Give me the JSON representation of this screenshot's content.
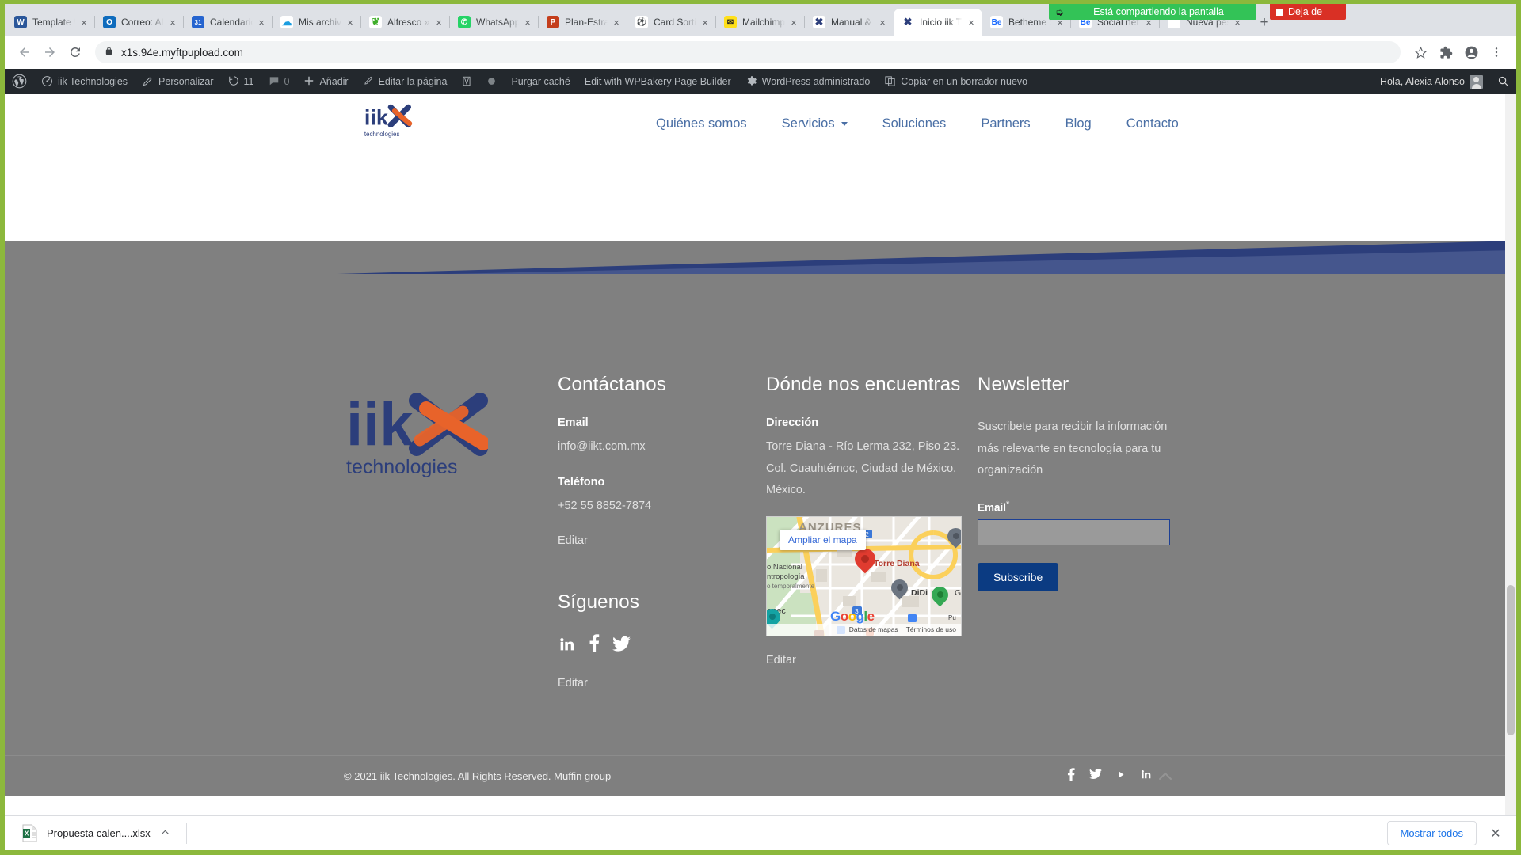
{
  "browser": {
    "tabs": [
      {
        "title": "Template W",
        "icon": "document-icon",
        "icon_bg": "#2b579a",
        "glyph": "W"
      },
      {
        "title": "Correo: Ale",
        "icon": "outlook-icon",
        "icon_bg": "#0f6cbd",
        "glyph": "O"
      },
      {
        "title": "Calendario:",
        "icon": "calendar-icon",
        "icon_bg": "#2564cf",
        "glyph": "31"
      },
      {
        "title": "Mis archivos",
        "icon": "onedrive-icon",
        "icon_bg": "#ffffff",
        "glyph": "☁"
      },
      {
        "title": "Alfresco » P",
        "icon": "alfresco-icon",
        "icon_bg": "#ffffff",
        "glyph": "❦"
      },
      {
        "title": "WhatsApp",
        "icon": "whatsapp-icon",
        "icon_bg": "#25d366",
        "glyph": "✆"
      },
      {
        "title": "Plan-Estrat",
        "icon": "powerpoint-icon",
        "icon_bg": "#c43e1c",
        "glyph": "P"
      },
      {
        "title": "Card Sorting",
        "icon": "optimal-workshop-icon",
        "icon_bg": "#ffffff",
        "glyph": "⚽"
      },
      {
        "title": "Mailchimp D",
        "icon": "mailchimp-icon",
        "icon_bg": "#ffe01b",
        "glyph": "✉"
      },
      {
        "title": "Manual & S",
        "icon": "iik-icon",
        "icon_bg": "#ffffff",
        "glyph": "✖"
      },
      {
        "title": "Inicio iik T",
        "icon": "iik-icon",
        "icon_bg": "#ffffff",
        "glyph": "✖",
        "active": true
      },
      {
        "title": "Betheme St",
        "icon": "behance-icon",
        "icon_bg": "#ffffff",
        "glyph": "Be"
      },
      {
        "title": "Social netw",
        "icon": "behance-icon",
        "icon_bg": "#ffffff",
        "glyph": "Be"
      },
      {
        "title": "Nueva pestaña",
        "icon": "blank-icon",
        "icon_bg": "#ffffff",
        "glyph": ""
      }
    ],
    "new_tab_label": "+",
    "close_label": "×",
    "share_notice": "Está compartiendo la pantalla",
    "stop_share_label": "Deja de",
    "back_label": "←",
    "forward_label": "→",
    "reload_label": "⟳",
    "url": "x1s.94e.myftpupload.com",
    "lock_label": "🔒",
    "bookmark_label": "☆",
    "extensions_label": "🧩",
    "profile_label": "👤",
    "menu_label": "⋮"
  },
  "wp_admin_bar": {
    "items": [
      {
        "label": "",
        "icon": "wordpress-logo-icon"
      },
      {
        "label": "iik Technologies",
        "icon": "dashboard-icon"
      },
      {
        "label": "Personalizar",
        "icon": "pencil-icon"
      },
      {
        "label": "11",
        "icon": "revision-icon"
      },
      {
        "label": "0",
        "icon": "comment-icon"
      },
      {
        "label": "Añadir",
        "icon": "plus-icon"
      },
      {
        "label": "Editar la página",
        "icon": "edit-icon"
      },
      {
        "label": "",
        "icon": "wpbakery-icon"
      },
      {
        "label": "Purgar caché",
        "icon": "cache-icon"
      },
      {
        "label": "Edit with WPBakery Page Builder",
        "icon": ""
      },
      {
        "label": "WordPress administrado",
        "icon": "gear-icon"
      },
      {
        "label": "Copiar en un borrador nuevo",
        "icon": "copy-icon"
      }
    ],
    "greeting": "Hola, Alexia Alonso",
    "search_icon": "search-icon"
  },
  "site": {
    "logo_main": "iik",
    "logo_sub": "technologies",
    "nav": [
      {
        "label": "Quiénes somos",
        "has_dropdown": false
      },
      {
        "label": "Servicios",
        "has_dropdown": true
      },
      {
        "label": "Soluciones",
        "has_dropdown": false
      },
      {
        "label": "Partners",
        "has_dropdown": false
      },
      {
        "label": "Blog",
        "has_dropdown": false
      },
      {
        "label": "Contacto",
        "has_dropdown": false
      }
    ],
    "accent_blue": "#2c3e7b",
    "footer_bg": "#808080"
  },
  "footer": {
    "contact": {
      "heading": "Contáctanos",
      "email_label": "Email",
      "email_value": "info@iikt.com.mx",
      "phone_label": "Teléfono",
      "phone_value": "+52 55 8852-7874",
      "edit_label": "Editar",
      "follow_heading": "Síguenos",
      "social": [
        "linkedin-icon",
        "facebook-icon",
        "twitter-icon"
      ],
      "follow_edit_label": "Editar"
    },
    "location": {
      "heading": "Dónde nos encuentras",
      "address_label": "Dirección",
      "address_lines": [
        "Torre Diana - Río Lerma 232, Piso 23.",
        "Col. Cuauhtémoc, Ciudad de México,",
        "México."
      ],
      "edit_label": "Editar",
      "map": {
        "expand_label": "Ampliar el mapa",
        "marker_label": "Torre Diana",
        "poi_didi": "DiDi",
        "poi_anzures": "ANZURES",
        "poi_museum_1": "o Nacional",
        "poi_museum_2": "ntropología",
        "poi_museum_3": "o temporalmente",
        "poi_chapultepec": "epec",
        "route_2": "2",
        "route_3": "3",
        "brand": "Google",
        "data_label": "Datos de mapas",
        "terms_label": "Términos de uso"
      }
    },
    "newsletter": {
      "heading": "Newsletter",
      "description": "Suscribete para recibir la información más relevante en tecnología para tu organización",
      "email_label": "Email",
      "required_mark": "*",
      "email_value": "",
      "email_placeholder": "",
      "submit_label": "Subscribe",
      "button_color": "#0b3b82"
    },
    "bottom": {
      "copyright": "© 2021 iik Technologies. All Rights Reserved. Muffin group",
      "social": [
        "facebook-icon",
        "twitter-icon",
        "youtube-icon",
        "linkedin-icon"
      ],
      "scroll_top_icon": "chevron-up-icon"
    }
  },
  "download_shelf": {
    "file_name": "Propuesta calen....xlsx",
    "file_icon": "excel-file-icon",
    "chevron_label": "⌃",
    "show_all_label": "Mostrar todos",
    "close_label": "✕"
  }
}
